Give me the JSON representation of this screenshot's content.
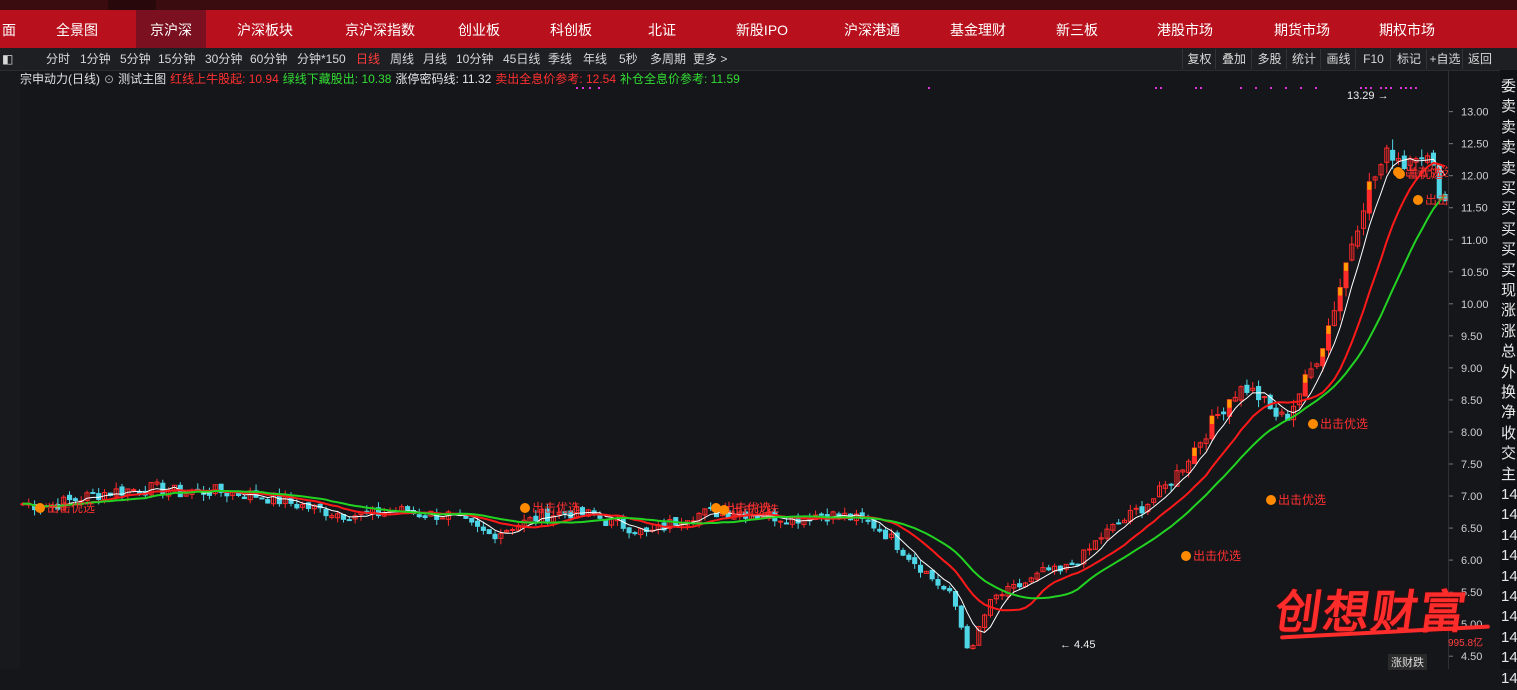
{
  "top_nav": {
    "items": [
      {
        "label": "面"
      },
      {
        "label": "全景图"
      },
      {
        "label": "京沪深"
      },
      {
        "label": "沪深板块"
      },
      {
        "label": "京沪深指数"
      },
      {
        "label": "创业板"
      },
      {
        "label": "科创板"
      },
      {
        "label": "北证"
      },
      {
        "label": "新股IPO"
      },
      {
        "label": "沪深港通"
      },
      {
        "label": "基金理财"
      },
      {
        "label": "新三板"
      },
      {
        "label": "港股市场"
      },
      {
        "label": "期货市场"
      },
      {
        "label": "期权市场"
      }
    ],
    "active_index": 2
  },
  "period_toolbar": {
    "items": [
      {
        "label": "分时"
      },
      {
        "label": "1分钟"
      },
      {
        "label": "5分钟"
      },
      {
        "label": "15分钟"
      },
      {
        "label": "30分钟"
      },
      {
        "label": "60分钟"
      },
      {
        "label": "分钟*150"
      },
      {
        "label": "日线"
      },
      {
        "label": "周线"
      },
      {
        "label": "月线"
      },
      {
        "label": "10分钟"
      },
      {
        "label": "45日线"
      },
      {
        "label": "季线"
      },
      {
        "label": "年线"
      },
      {
        "label": "5秒"
      },
      {
        "label": "多周期"
      },
      {
        "label": "更多 >"
      }
    ],
    "active_index": 7,
    "right_buttons": [
      {
        "label": "复权"
      },
      {
        "label": "叠加"
      },
      {
        "label": "多股"
      },
      {
        "label": "统计"
      },
      {
        "label": "画线"
      },
      {
        "label": "F10"
      },
      {
        "label": "标记"
      },
      {
        "label": "+自选"
      },
      {
        "label": "返回"
      }
    ]
  },
  "info_line": {
    "stock_name": "宗申动力(日线)",
    "template": "测试主图",
    "items": [
      {
        "text": "红线上牛股起: 10.94",
        "color": "#ff3030"
      },
      {
        "text": "绿线下藏股出: 10.38",
        "color": "#33dd33"
      },
      {
        "text": "涨停密码线: 11.32",
        "color": "#e6e6e6"
      },
      {
        "text": "卖出全息价参考: 12.54",
        "color": "#ff3030"
      },
      {
        "text": "补仓全息价参考: 11.59",
        "color": "#33dd33"
      }
    ]
  },
  "price_axis": {
    "labels": [
      "13.00",
      "12.50",
      "12.00",
      "11.50",
      "11.00",
      "10.50",
      "10.00",
      "9.50",
      "9.00",
      "8.50",
      "8.00",
      "7.50",
      "7.00",
      "6.50",
      "6.00",
      "5.50",
      "5.00",
      "4.50"
    ]
  },
  "right_panel": {
    "labels": [
      "委",
      "卖",
      "卖",
      "卖",
      "卖",
      "买",
      "买",
      "买",
      "买",
      "买",
      "现",
      "涨",
      "涨",
      "总",
      "外",
      "换",
      "净",
      "收",
      "交",
      "主",
      "14",
      "14",
      "14",
      "14",
      "14",
      "14",
      "14",
      "14",
      "14",
      "14"
    ]
  },
  "annotations": {
    "high_label": "13.29",
    "low_label": "4.45",
    "signals": [
      "出击优选",
      "出击优选",
      "出击优选",
      "出击优选",
      "出击优选",
      "出击优选",
      "出击优选",
      "出击优选",
      "击优选",
      "出击"
    ]
  },
  "watermark": {
    "text": "创想财富",
    "sub": "995.8亿",
    "bottom_tag": "涨财跌"
  },
  "colors": {
    "up": "#ff2a2a",
    "down": "#4fd6e6",
    "ma_white": "#ffffff",
    "ma_red": "#ff1a1a",
    "ma_green": "#22d322",
    "signal_pink": "#dd33dd",
    "yellow": "#ffd000",
    "orange": "#ff9a00"
  },
  "chart_data": {
    "type": "candlestick",
    "ylim": [
      4.3,
      13.4
    ],
    "ohlc_count": 245,
    "points": [
      [
        0,
        6.88
      ],
      [
        10,
        6.85
      ],
      [
        20,
        6.95
      ],
      [
        30,
        7.05
      ],
      [
        40,
        7.1
      ],
      [
        50,
        7.12
      ],
      [
        60,
        7.05
      ],
      [
        70,
        7.08
      ],
      [
        80,
        7.05
      ],
      [
        90,
        7.0
      ],
      [
        100,
        6.9
      ],
      [
        110,
        6.8
      ],
      [
        120,
        6.72
      ],
      [
        130,
        6.7
      ],
      [
        140,
        6.78
      ],
      [
        150,
        6.72
      ],
      [
        160,
        6.7
      ],
      [
        165,
        6.6
      ],
      [
        170,
        6.5
      ],
      [
        175,
        6.4
      ],
      [
        180,
        6.45
      ],
      [
        185,
        6.55
      ],
      [
        190,
        6.6
      ],
      [
        195,
        6.7
      ],
      [
        200,
        6.72
      ],
      [
        205,
        6.75
      ],
      [
        210,
        6.72
      ],
      [
        215,
        6.7
      ],
      [
        220,
        6.6
      ],
      [
        225,
        6.55
      ],
      [
        230,
        6.5
      ],
      [
        235,
        6.4
      ],
      [
        240,
        6.5
      ],
      [
        245,
        6.6
      ],
      [
        250,
        6.7
      ],
      [
        260,
        6.75
      ],
      [
        270,
        6.75
      ],
      [
        280,
        6.7
      ],
      [
        290,
        6.65
      ],
      [
        300,
        6.72
      ],
      [
        310,
        6.68
      ],
      [
        320,
        6.55
      ],
      [
        325,
        6.4
      ],
      [
        330,
        6.2
      ],
      [
        335,
        6.0
      ],
      [
        340,
        5.8
      ],
      [
        345,
        5.6
      ],
      [
        350,
        5.4
      ],
      [
        352,
        5.1
      ],
      [
        355,
        4.7
      ],
      [
        357,
        4.55
      ],
      [
        360,
        5.0
      ],
      [
        365,
        5.4
      ],
      [
        370,
        5.5
      ],
      [
        375,
        5.6
      ],
      [
        380,
        5.7
      ],
      [
        385,
        5.85
      ],
      [
        390,
        5.8
      ],
      [
        395,
        5.95
      ],
      [
        400,
        6.1
      ],
      [
        405,
        6.35
      ],
      [
        410,
        6.5
      ],
      [
        415,
        6.65
      ],
      [
        420,
        6.8
      ],
      [
        425,
        6.95
      ],
      [
        430,
        7.15
      ],
      [
        435,
        7.4
      ],
      [
        440,
        7.7
      ],
      [
        445,
        8.0
      ],
      [
        450,
        8.3
      ],
      [
        455,
        8.6
      ],
      [
        460,
        8.7
      ],
      [
        465,
        8.55
      ],
      [
        470,
        8.3
      ],
      [
        475,
        8.2
      ],
      [
        480,
        8.6
      ],
      [
        485,
        9.0
      ],
      [
        490,
        9.5
      ],
      [
        495,
        10.2
      ],
      [
        500,
        11.0
      ],
      [
        505,
        11.7
      ],
      [
        510,
        12.1
      ],
      [
        515,
        12.4
      ],
      [
        520,
        12.2
      ],
      [
        525,
        12.5
      ],
      [
        530,
        12.1
      ],
      [
        535,
        11.6
      ]
    ]
  }
}
